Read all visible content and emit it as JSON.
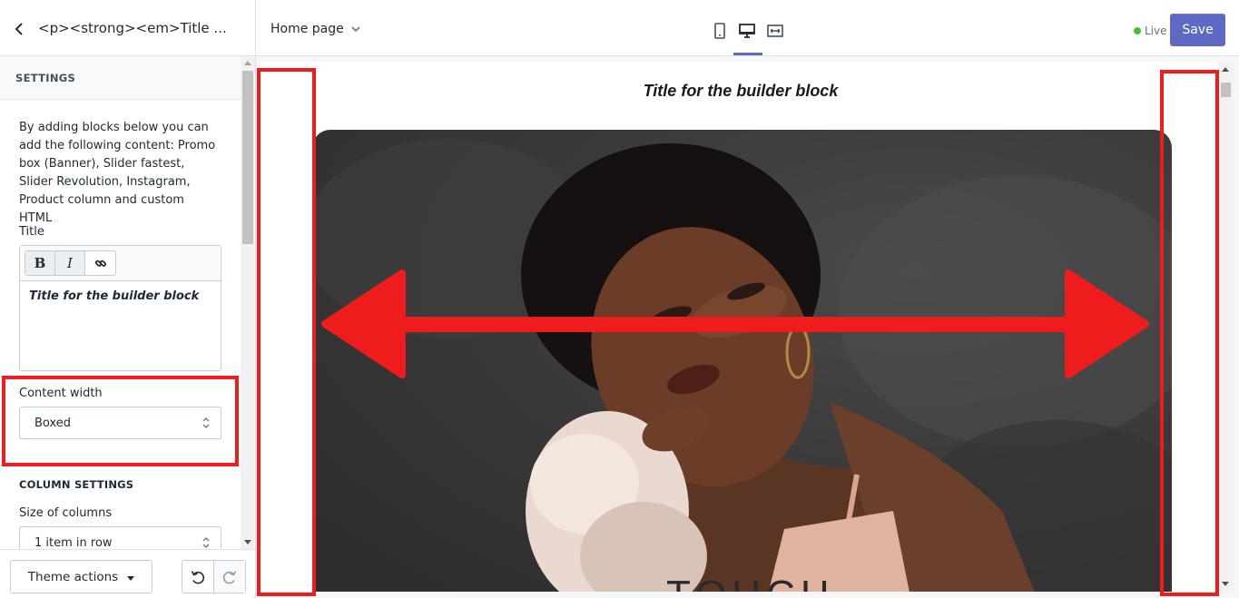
{
  "sidebar": {
    "title": "<p><strong><em>Title ...",
    "section_heading": "SETTINGS",
    "description": "By adding blocks below you can add the following content: Promo box (Banner), Slider fastest, Slider Revolution, Instagram, Product column and custom HTML",
    "title_label": "Title",
    "rte": {
      "bold_label": "B",
      "italic_label": "I",
      "content": "Title for the builder block"
    },
    "content_width": {
      "label": "Content width",
      "value": "Boxed"
    },
    "column_settings_heading": "COLUMN SETTINGS",
    "size_of_columns": {
      "label": "Size of columns",
      "value": "1 item in row"
    },
    "footer": {
      "theme_actions_label": "Theme actions"
    }
  },
  "topbar": {
    "page_selector": "Home page",
    "status": "Live",
    "save_label": "Save",
    "active_view": "desktop"
  },
  "preview": {
    "title": "Title for the builder block",
    "hero_text": "TOUCH"
  },
  "colors": {
    "accent": "#5c6ac4",
    "live": "#50b83c",
    "annotation": "#ee1c1c"
  },
  "icons": {
    "back": "chevron-left-icon",
    "page_dropdown": "chevron-down-icon",
    "mobile": "mobile-icon",
    "desktop": "desktop-icon",
    "fullwidth": "fullwidth-icon",
    "link": "link-icon",
    "undo": "undo-icon",
    "redo": "redo-icon"
  }
}
